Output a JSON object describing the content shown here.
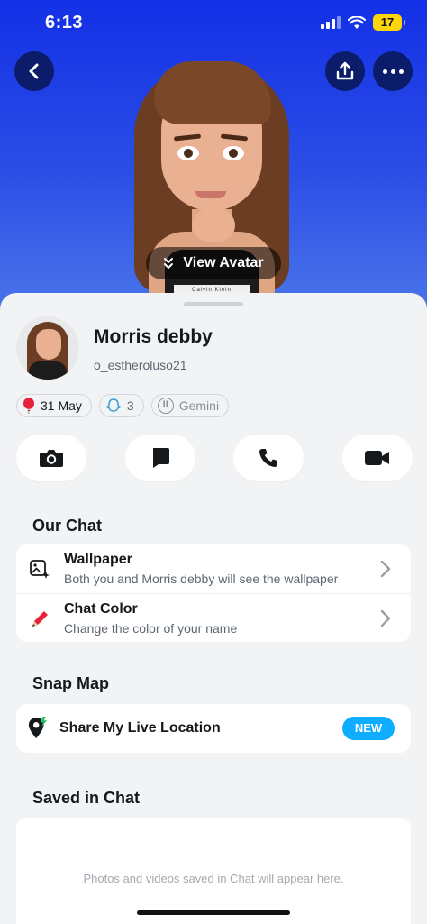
{
  "status": {
    "time": "6:13",
    "battery": "17"
  },
  "header": {
    "view_avatar_label": "View Avatar",
    "waistband_text": "Calvin Klein"
  },
  "profile": {
    "name": "Morris debby",
    "username": "o_estheroluso21",
    "chips": {
      "birthday": "31 May",
      "friends": "3",
      "zodiac": "Gemini"
    }
  },
  "sections": {
    "our_chat": {
      "title": "Our Chat",
      "items": [
        {
          "title": "Wallpaper",
          "subtitle": "Both you and Morris debby will see the wallpaper",
          "icon": "wallpaper-icon"
        },
        {
          "title": "Chat Color",
          "subtitle": "Change the color of your name",
          "icon": "pencil-icon"
        }
      ]
    },
    "snap_map": {
      "title": "Snap Map",
      "item_label": "Share My Live Location",
      "badge": "NEW"
    },
    "saved": {
      "title": "Saved in Chat",
      "empty_text": "Photos and videos saved in Chat will appear here."
    }
  },
  "actions": [
    {
      "name": "camera",
      "icon": "camera-icon"
    },
    {
      "name": "chat",
      "icon": "chat-bubble-icon"
    },
    {
      "name": "call",
      "icon": "phone-icon"
    },
    {
      "name": "video",
      "icon": "video-icon"
    }
  ],
  "colors": {
    "hero_top": "#1330e6",
    "accent": "#0fadff",
    "sheet_bg": "#f2f3f5"
  }
}
